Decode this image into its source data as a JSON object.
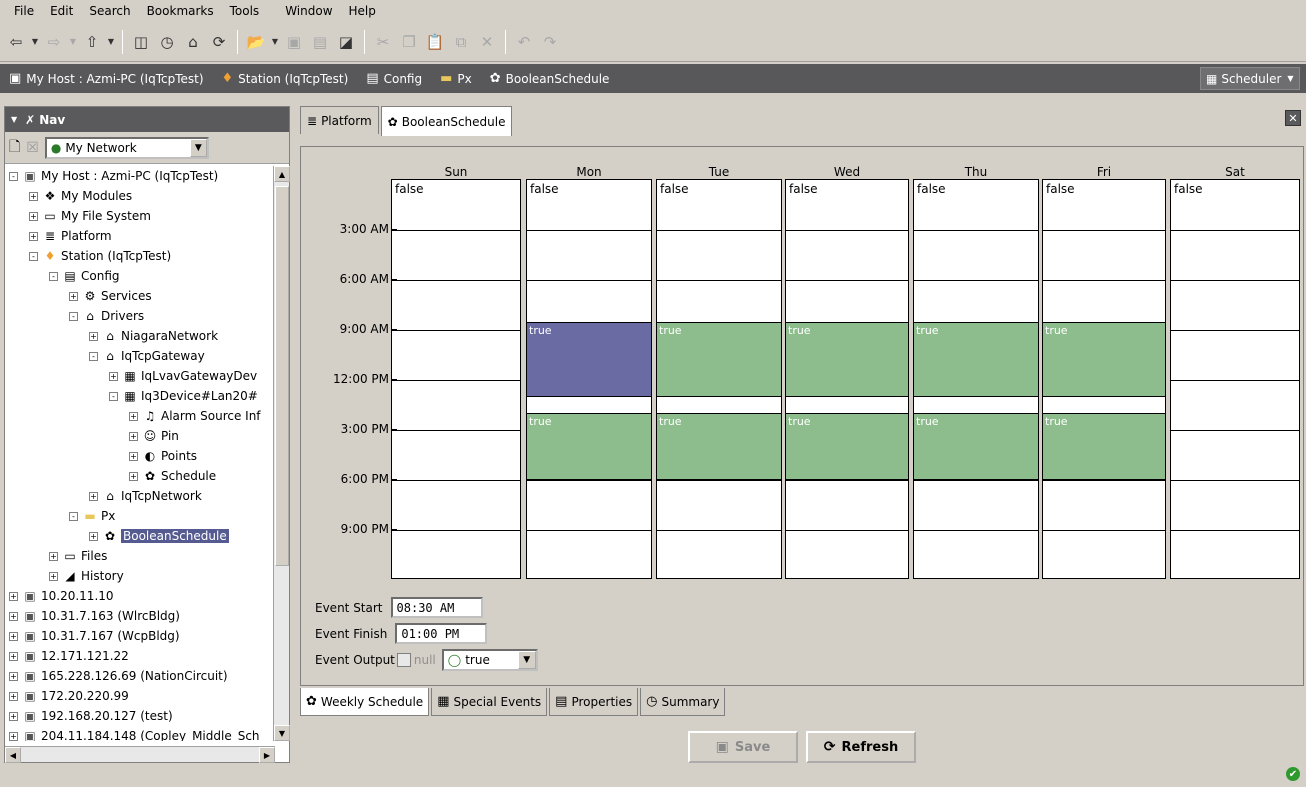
{
  "menu": [
    "File",
    "Edit",
    "Search",
    "Bookmarks",
    "Tools",
    "Window",
    "Help"
  ],
  "breadcrumb": [
    {
      "label": "My Host : Azmi-PC (IqTcpTest)",
      "icon": "host-icon"
    },
    {
      "label": "Station (IqTcpTest)",
      "icon": "station-icon"
    },
    {
      "label": "Config",
      "icon": "config-icon"
    },
    {
      "label": "Px",
      "icon": "folder-icon"
    },
    {
      "label": "BooleanSchedule",
      "icon": "schedule-icon"
    }
  ],
  "profile": {
    "label": "Scheduler"
  },
  "nav": {
    "title": "Nav",
    "combo": "My Network",
    "tree": [
      {
        "label": "My Host : Azmi-PC (IqTcpTest)",
        "level": 0,
        "exp": "-",
        "icon": "▣"
      },
      {
        "label": "My Modules",
        "level": 1,
        "exp": "+",
        "icon": "❖"
      },
      {
        "label": "My File System",
        "level": 1,
        "exp": "+",
        "icon": "▭"
      },
      {
        "label": "Platform",
        "level": 1,
        "exp": "+",
        "icon": "≣"
      },
      {
        "label": "Station (IqTcpTest)",
        "level": 1,
        "exp": "-",
        "icon": "♦"
      },
      {
        "label": "Config",
        "level": 2,
        "exp": "-",
        "icon": "▤"
      },
      {
        "label": "Services",
        "level": 3,
        "exp": "+",
        "icon": "⚙"
      },
      {
        "label": "Drivers",
        "level": 3,
        "exp": "-",
        "icon": "⌂"
      },
      {
        "label": "NiagaraNetwork",
        "level": 4,
        "exp": "+",
        "icon": "⌂"
      },
      {
        "label": "IqTcpGateway",
        "level": 4,
        "exp": "-",
        "icon": "⌂"
      },
      {
        "label": "IqLvavGatewayDev",
        "level": 5,
        "exp": "+",
        "icon": "▦"
      },
      {
        "label": "Iq3Device#Lan20#",
        "level": 5,
        "exp": "-",
        "icon": "▦"
      },
      {
        "label": "Alarm Source Inf",
        "level": 6,
        "exp": "+",
        "icon": "♫"
      },
      {
        "label": "Pin",
        "level": 6,
        "exp": "+",
        "icon": "☺"
      },
      {
        "label": "Points",
        "level": 6,
        "exp": "+",
        "icon": "◐"
      },
      {
        "label": "Schedule",
        "level": 6,
        "exp": "+",
        "icon": "✿"
      },
      {
        "label": "IqTcpNetwork",
        "level": 4,
        "exp": "+",
        "icon": "⌂"
      },
      {
        "label": "Px",
        "level": 3,
        "exp": "-",
        "icon": "▬"
      },
      {
        "label": "BooleanSchedule",
        "level": 4,
        "exp": "+",
        "icon": "✿",
        "selected": true
      },
      {
        "label": "Files",
        "level": 2,
        "exp": "+",
        "icon": "▭"
      },
      {
        "label": "History",
        "level": 2,
        "exp": "+",
        "icon": "◢"
      },
      {
        "label": "10.20.11.10",
        "level": 0,
        "exp": "+",
        "icon": "▣"
      },
      {
        "label": "10.31.7.163 (WlrcBldg)",
        "level": 0,
        "exp": "+",
        "icon": "▣"
      },
      {
        "label": "10.31.7.167 (WcpBldg)",
        "level": 0,
        "exp": "+",
        "icon": "▣"
      },
      {
        "label": "12.171.121.22",
        "level": 0,
        "exp": "+",
        "icon": "▣"
      },
      {
        "label": "165.228.126.69 (NationCircuit)",
        "level": 0,
        "exp": "+",
        "icon": "▣"
      },
      {
        "label": "172.20.220.99",
        "level": 0,
        "exp": "+",
        "icon": "▣"
      },
      {
        "label": "192.168.20.127 (test)",
        "level": 0,
        "exp": "+",
        "icon": "▣"
      },
      {
        "label": "204.11.184.148 (Copley_Middle_Sch",
        "level": 0,
        "exp": "+",
        "icon": "▣"
      }
    ]
  },
  "view_tabs": [
    {
      "label": "Platform",
      "icon": "platform-icon",
      "active": false
    },
    {
      "label": "BooleanSchedule",
      "icon": "schedule-icon",
      "active": true
    }
  ],
  "schedule": {
    "days": [
      "Sun",
      "Mon",
      "Tue",
      "Wed",
      "Thu",
      "Fri",
      "Sat"
    ],
    "times": [
      "3:00 AM",
      "6:00 AM",
      "9:00 AM",
      "12:00 PM",
      "3:00 PM",
      "6:00 PM",
      "9:00 PM"
    ],
    "default_value": "false",
    "events": [
      {
        "day": 1,
        "start": 8.5,
        "end": 13,
        "value": "true",
        "selected": true
      },
      {
        "day": 2,
        "start": 8.5,
        "end": 13,
        "value": "true"
      },
      {
        "day": 3,
        "start": 8.5,
        "end": 13,
        "value": "true"
      },
      {
        "day": 4,
        "start": 8.5,
        "end": 13,
        "value": "true"
      },
      {
        "day": 5,
        "start": 8.5,
        "end": 13,
        "value": "true"
      },
      {
        "day": 1,
        "start": 14,
        "end": 18,
        "value": "true"
      },
      {
        "day": 2,
        "start": 14,
        "end": 18,
        "value": "true"
      },
      {
        "day": 3,
        "start": 14,
        "end": 18,
        "value": "true"
      },
      {
        "day": 4,
        "start": 14,
        "end": 18,
        "value": "true"
      },
      {
        "day": 5,
        "start": 14,
        "end": 18,
        "value": "true"
      }
    ],
    "event_start_label": "Event Start",
    "event_start": "08:30 AM",
    "event_finish_label": "Event Finish",
    "event_finish": "01:00 PM",
    "event_output_label": "Event Output",
    "null_label": "null",
    "output_value": "true"
  },
  "bottom_tabs": [
    {
      "label": "Weekly Schedule",
      "icon": "✿",
      "active": true
    },
    {
      "label": "Special Events",
      "icon": "▦",
      "active": false
    },
    {
      "label": "Properties",
      "icon": "▤",
      "active": false
    },
    {
      "label": "Summary",
      "icon": "◷",
      "active": false
    }
  ],
  "buttons": {
    "save": "Save",
    "refresh": "Refresh"
  },
  "colors": {
    "event": "#8ebd8d",
    "event_selected": "#6b6ba4",
    "header": "#58585a"
  }
}
